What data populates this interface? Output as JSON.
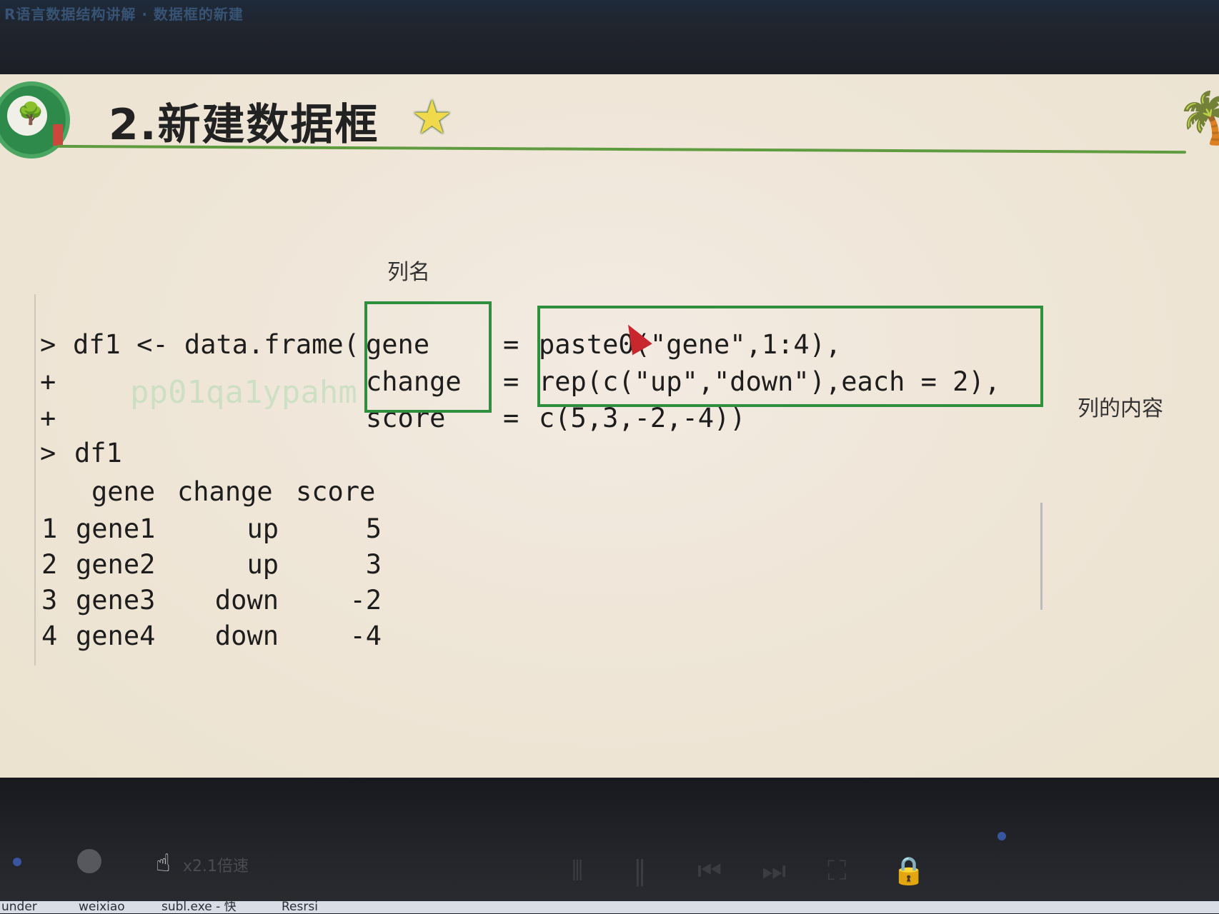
{
  "window": {
    "title": "R语言数据结构讲解 · 数据框的新建"
  },
  "slide": {
    "title": "2.新建数据框",
    "label_column_name": "列名",
    "label_column_content": "列的内容"
  },
  "code": {
    "line1_prompt": ">",
    "line1_lhs": "df1 <- data.frame(",
    "line1_name": "gene",
    "line1_eq": "=",
    "line1_value": "paste0(\"gene\",1:4),",
    "line2_prompt": "+",
    "line2_name": "change",
    "line2_eq": "=",
    "line2_value": "rep(c(\"up\",\"down\"),each = 2),",
    "line3_prompt": "+",
    "line3_name": "score",
    "line3_eq": "=",
    "line3_value": "c(5,3,-2,-4))",
    "line4_prompt": ">",
    "line4_cmd": "df1",
    "watermark": "pp01qa1ypahm"
  },
  "dataframe": {
    "headers": [
      "gene",
      "change",
      "score"
    ],
    "rows": [
      {
        "index": "1",
        "gene": "gene1",
        "change": "up",
        "score": "5"
      },
      {
        "index": "2",
        "gene": "gene2",
        "change": "up",
        "score": "3"
      },
      {
        "index": "3",
        "gene": "gene3",
        "change": "down",
        "score": "-2"
      },
      {
        "index": "4",
        "gene": "gene4",
        "change": "down",
        "score": "-4"
      }
    ]
  },
  "player": {
    "speed_label": "x2.1倍速"
  },
  "taskbar": {
    "items": [
      "under",
      "weixiao",
      "subl.exe - 快",
      "Resrsi"
    ]
  },
  "colors": {
    "box_green": "#2f8f3e",
    "cursor_red": "#c7282e",
    "slide_bg": "#efe6d8"
  }
}
